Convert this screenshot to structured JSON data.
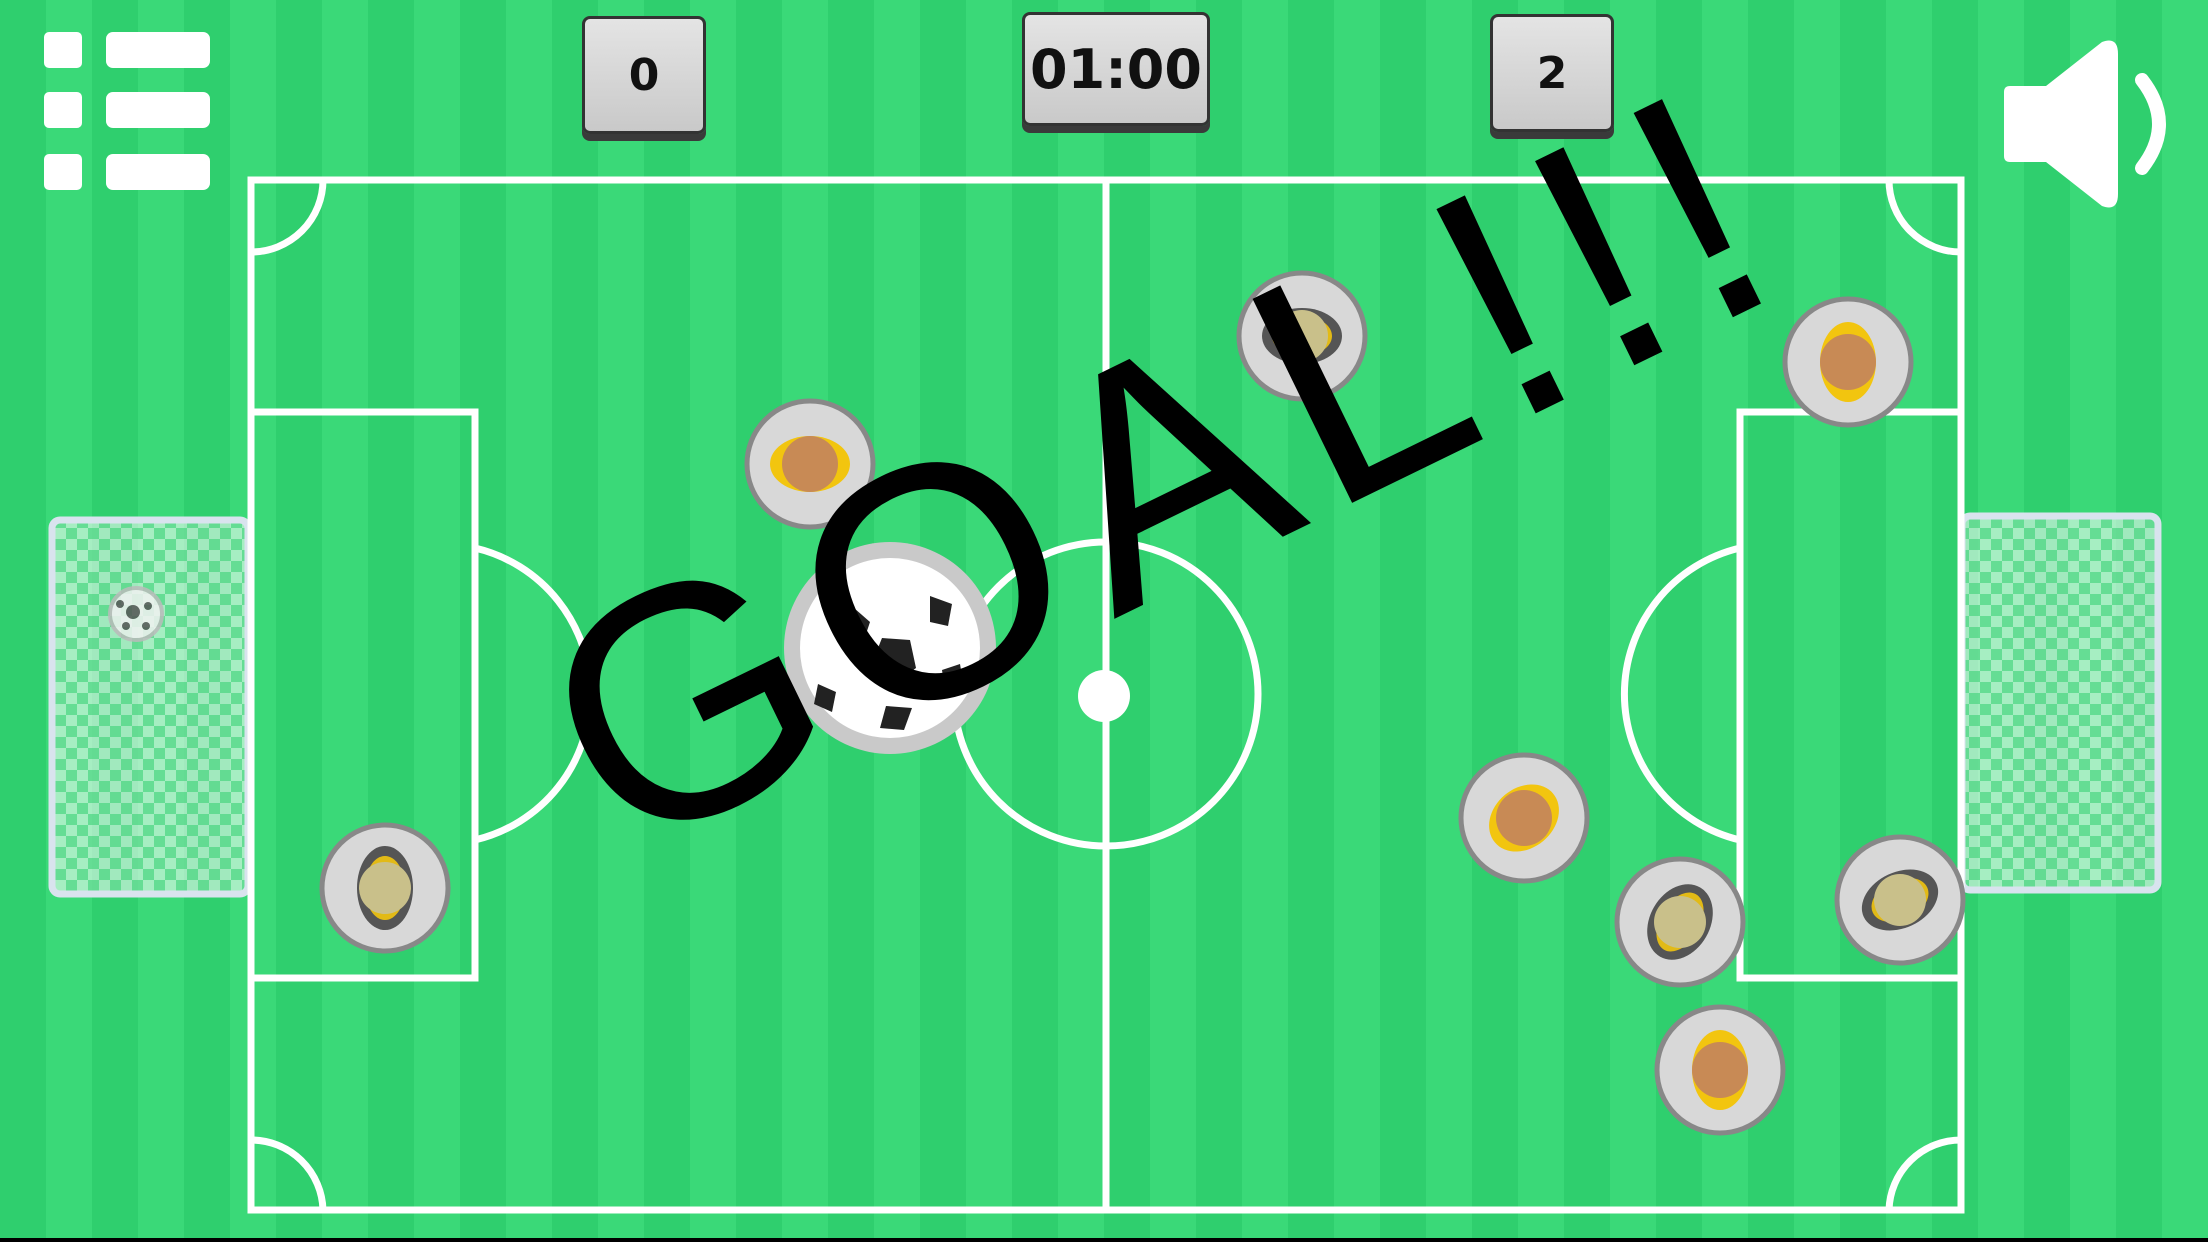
{
  "scoreboard": {
    "left_score": "0",
    "right_score": "2",
    "timer": "01:00"
  },
  "banner": {
    "goal_text": "GOAL!!!"
  },
  "icons": {
    "menu": "menu-icon",
    "sound": "speaker-icon",
    "ball": "soccer-ball-icon"
  },
  "colors": {
    "pitch_light": "#3ad978",
    "pitch_dark": "#2fcf6e",
    "lines": "#ffffff",
    "team_yellow": "#f2c50f",
    "team_dark": "#555555",
    "player_head": "#c88a55",
    "player_head_alt": "#c9c08a"
  }
}
